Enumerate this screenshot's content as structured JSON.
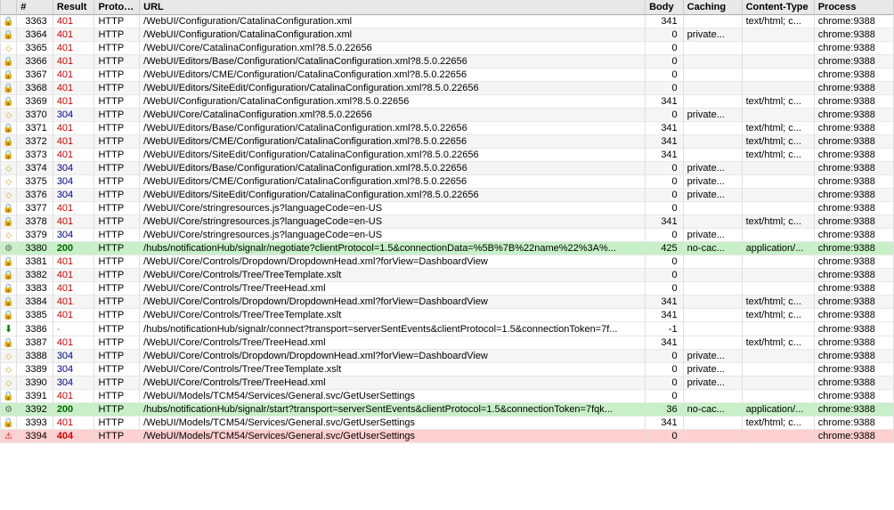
{
  "table": {
    "columns": [
      "",
      "#",
      "Result",
      "Protocol",
      "URL",
      "Body",
      "Caching",
      "Content-Type",
      "Process"
    ],
    "rows": [
      {
        "icon": "lock",
        "num": "3363",
        "result": "401",
        "resultClass": "result-401",
        "protocol": "HTTP",
        "url": "/WebUI/Configuration/CatalinaConfiguration.xml",
        "body": "341",
        "caching": "",
        "contentType": "text/html; c...",
        "process": "chrome:9388",
        "rowClass": ""
      },
      {
        "icon": "lock",
        "num": "3364",
        "result": "401",
        "resultClass": "result-401",
        "protocol": "HTTP",
        "url": "/WebUI/Configuration/CatalinaConfiguration.xml",
        "body": "0",
        "caching": "private...",
        "contentType": "",
        "process": "chrome:9388",
        "rowClass": "row-even"
      },
      {
        "icon": "diamond",
        "num": "3365",
        "result": "401",
        "resultClass": "result-401",
        "protocol": "HTTP",
        "url": "/WebUI/Core/CatalinaConfiguration.xml?8.5.0.22656",
        "body": "0",
        "caching": "",
        "contentType": "",
        "process": "chrome:9388",
        "rowClass": ""
      },
      {
        "icon": "lock",
        "num": "3366",
        "result": "401",
        "resultClass": "result-401",
        "protocol": "HTTP",
        "url": "/WebUI/Editors/Base/Configuration/CatalinaConfiguration.xml?8.5.0.22656",
        "body": "0",
        "caching": "",
        "contentType": "",
        "process": "chrome:9388",
        "rowClass": "row-even"
      },
      {
        "icon": "lock",
        "num": "3367",
        "result": "401",
        "resultClass": "result-401",
        "protocol": "HTTP",
        "url": "/WebUI/Editors/CME/Configuration/CatalinaConfiguration.xml?8.5.0.22656",
        "body": "0",
        "caching": "",
        "contentType": "",
        "process": "chrome:9388",
        "rowClass": ""
      },
      {
        "icon": "lock",
        "num": "3368",
        "result": "401",
        "resultClass": "result-401",
        "protocol": "HTTP",
        "url": "/WebUI/Editors/SiteEdit/Configuration/CatalinaConfiguration.xml?8.5.0.22656",
        "body": "0",
        "caching": "",
        "contentType": "",
        "process": "chrome:9388",
        "rowClass": "row-even"
      },
      {
        "icon": "lock",
        "num": "3369",
        "result": "401",
        "resultClass": "result-401",
        "protocol": "HTTP",
        "url": "/WebUI/Configuration/CatalinaConfiguration.xml?8.5.0.22656",
        "body": "341",
        "caching": "",
        "contentType": "text/html; c...",
        "process": "chrome:9388",
        "rowClass": ""
      },
      {
        "icon": "diamond",
        "num": "3370",
        "result": "304",
        "resultClass": "result-304",
        "protocol": "HTTP",
        "url": "/WebUI/Core/CatalinaConfiguration.xml?8.5.0.22656",
        "body": "0",
        "caching": "private...",
        "contentType": "",
        "process": "chrome:9388",
        "rowClass": "row-even"
      },
      {
        "icon": "lock",
        "num": "3371",
        "result": "401",
        "resultClass": "result-401",
        "protocol": "HTTP",
        "url": "/WebUI/Editors/Base/Configuration/CatalinaConfiguration.xml?8.5.0.22656",
        "body": "341",
        "caching": "",
        "contentType": "text/html; c...",
        "process": "chrome:9388",
        "rowClass": ""
      },
      {
        "icon": "lock",
        "num": "3372",
        "result": "401",
        "resultClass": "result-401",
        "protocol": "HTTP",
        "url": "/WebUI/Editors/CME/Configuration/CatalinaConfiguration.xml?8.5.0.22656",
        "body": "341",
        "caching": "",
        "contentType": "text/html; c...",
        "process": "chrome:9388",
        "rowClass": "row-even"
      },
      {
        "icon": "lock",
        "num": "3373",
        "result": "401",
        "resultClass": "result-401",
        "protocol": "HTTP",
        "url": "/WebUI/Editors/SiteEdit/Configuration/CatalinaConfiguration.xml?8.5.0.22656",
        "body": "341",
        "caching": "",
        "contentType": "text/html; c...",
        "process": "chrome:9388",
        "rowClass": ""
      },
      {
        "icon": "diamond",
        "num": "3374",
        "result": "304",
        "resultClass": "result-304",
        "protocol": "HTTP",
        "url": "/WebUI/Editors/Base/Configuration/CatalinaConfiguration.xml?8.5.0.22656",
        "body": "0",
        "caching": "private...",
        "contentType": "",
        "process": "chrome:9388",
        "rowClass": "row-even"
      },
      {
        "icon": "diamond",
        "num": "3375",
        "result": "304",
        "resultClass": "result-304",
        "protocol": "HTTP",
        "url": "/WebUI/Editors/CME/Configuration/CatalinaConfiguration.xml?8.5.0.22656",
        "body": "0",
        "caching": "private...",
        "contentType": "",
        "process": "chrome:9388",
        "rowClass": ""
      },
      {
        "icon": "diamond",
        "num": "3376",
        "result": "304",
        "resultClass": "result-304",
        "protocol": "HTTP",
        "url": "/WebUI/Editors/SiteEdit/Configuration/CatalinaConfiguration.xml?8.5.0.22656",
        "body": "0",
        "caching": "private...",
        "contentType": "",
        "process": "chrome:9388",
        "rowClass": "row-even"
      },
      {
        "icon": "lock",
        "num": "3377",
        "result": "401",
        "resultClass": "result-401",
        "protocol": "HTTP",
        "url": "/WebUI/Core/stringresources.js?languageCode=en-US",
        "body": "0",
        "caching": "",
        "contentType": "",
        "process": "chrome:9388",
        "rowClass": ""
      },
      {
        "icon": "lock",
        "num": "3378",
        "result": "401",
        "resultClass": "result-401",
        "protocol": "HTTP",
        "url": "/WebUI/Core/stringresources.js?languageCode=en-US",
        "body": "341",
        "caching": "",
        "contentType": "text/html; c...",
        "process": "chrome:9388",
        "rowClass": "row-even"
      },
      {
        "icon": "diamond",
        "num": "3379",
        "result": "304",
        "resultClass": "result-304",
        "protocol": "HTTP",
        "url": "/WebUI/Core/stringresources.js?languageCode=en-US",
        "body": "0",
        "caching": "private...",
        "contentType": "",
        "process": "chrome:9388",
        "rowClass": ""
      },
      {
        "icon": "gear",
        "num": "3380",
        "result": "200",
        "resultClass": "result-200",
        "protocol": "HTTP",
        "url": "/hubs/notificationHub/signalr/negotiate?clientProtocol=1.5&connectionData=%5B%7B%22name%22%3A%...",
        "body": "425",
        "caching": "no-cac...",
        "contentType": "application/...",
        "process": "chrome:9388",
        "rowClass": "row-highlight-green"
      },
      {
        "icon": "lock",
        "num": "3381",
        "result": "401",
        "resultClass": "result-401",
        "protocol": "HTTP",
        "url": "/WebUI/Core/Controls/Dropdown/DropdownHead.xml?forView=DashboardView",
        "body": "0",
        "caching": "",
        "contentType": "",
        "process": "chrome:9388",
        "rowClass": ""
      },
      {
        "icon": "lock",
        "num": "3382",
        "result": "401",
        "resultClass": "result-401",
        "protocol": "HTTP",
        "url": "/WebUI/Core/Controls/Tree/TreeTemplate.xslt",
        "body": "0",
        "caching": "",
        "contentType": "",
        "process": "chrome:9388",
        "rowClass": "row-even"
      },
      {
        "icon": "lock",
        "num": "3383",
        "result": "401",
        "resultClass": "result-401",
        "protocol": "HTTP",
        "url": "/WebUI/Core/Controls/Tree/TreeHead.xml",
        "body": "0",
        "caching": "",
        "contentType": "",
        "process": "chrome:9388",
        "rowClass": ""
      },
      {
        "icon": "lock",
        "num": "3384",
        "result": "401",
        "resultClass": "result-401",
        "protocol": "HTTP",
        "url": "/WebUI/Core/Controls/Dropdown/DropdownHead.xml?forView=DashboardView",
        "body": "341",
        "caching": "",
        "contentType": "text/html; c...",
        "process": "chrome:9388",
        "rowClass": "row-even"
      },
      {
        "icon": "lock",
        "num": "3385",
        "result": "401",
        "resultClass": "result-401",
        "protocol": "HTTP",
        "url": "/WebUI/Core/Controls/Tree/TreeTemplate.xslt",
        "body": "341",
        "caching": "",
        "contentType": "text/html; c...",
        "process": "chrome:9388",
        "rowClass": ""
      },
      {
        "icon": "download",
        "num": "3386",
        "result": "-",
        "resultClass": "result-dash",
        "protocol": "HTTP",
        "url": "/hubs/notificationHub/signalr/connect?transport=serverSentEvents&clientProtocol=1.5&connectionToken=7f...",
        "body": "-1",
        "caching": "",
        "contentType": "",
        "process": "chrome:9388",
        "rowClass": "row-download"
      },
      {
        "icon": "lock",
        "num": "3387",
        "result": "401",
        "resultClass": "result-401",
        "protocol": "HTTP",
        "url": "/WebUI/Core/Controls/Tree/TreeHead.xml",
        "body": "341",
        "caching": "",
        "contentType": "text/html; c...",
        "process": "chrome:9388",
        "rowClass": ""
      },
      {
        "icon": "diamond",
        "num": "3388",
        "result": "304",
        "resultClass": "result-304",
        "protocol": "HTTP",
        "url": "/WebUI/Core/Controls/Dropdown/DropdownHead.xml?forView=DashboardView",
        "body": "0",
        "caching": "private...",
        "contentType": "",
        "process": "chrome:9388",
        "rowClass": "row-even"
      },
      {
        "icon": "diamond",
        "num": "3389",
        "result": "304",
        "resultClass": "result-304",
        "protocol": "HTTP",
        "url": "/WebUI/Core/Controls/Tree/TreeTemplate.xslt",
        "body": "0",
        "caching": "private...",
        "contentType": "",
        "process": "chrome:9388",
        "rowClass": ""
      },
      {
        "icon": "diamond",
        "num": "3390",
        "result": "304",
        "resultClass": "result-304",
        "protocol": "HTTP",
        "url": "/WebUI/Core/Controls/Tree/TreeHead.xml",
        "body": "0",
        "caching": "private...",
        "contentType": "",
        "process": "chrome:9388",
        "rowClass": "row-even"
      },
      {
        "icon": "lock",
        "num": "3391",
        "result": "401",
        "resultClass": "result-401",
        "protocol": "HTTP",
        "url": "/WebUI/Models/TCM54/Services/General.svc/GetUserSettings",
        "body": "0",
        "caching": "",
        "contentType": "",
        "process": "chrome:9388",
        "rowClass": ""
      },
      {
        "icon": "gear",
        "num": "3392",
        "result": "200",
        "resultClass": "result-200",
        "protocol": "HTTP",
        "url": "/hubs/notificationHub/signalr/start?transport=serverSentEvents&clientProtocol=1.5&connectionToken=7fqk...",
        "body": "36",
        "caching": "no-cac...",
        "contentType": "application/...",
        "process": "chrome:9388",
        "rowClass": "row-highlight-green"
      },
      {
        "icon": "lock",
        "num": "3393",
        "result": "401",
        "resultClass": "result-401",
        "protocol": "HTTP",
        "url": "/WebUI/Models/TCM54/Services/General.svc/GetUserSettings",
        "body": "341",
        "caching": "",
        "contentType": "text/html; c...",
        "process": "chrome:9388",
        "rowClass": ""
      },
      {
        "icon": "warning",
        "num": "3394",
        "result": "404",
        "resultClass": "result-404",
        "protocol": "HTTP",
        "url": "/WebUI/Models/TCM54/Services/General.svc/GetUserSettings",
        "body": "0",
        "caching": "",
        "contentType": "",
        "process": "chrome:9388",
        "rowClass": "row-highlight-red"
      }
    ]
  }
}
